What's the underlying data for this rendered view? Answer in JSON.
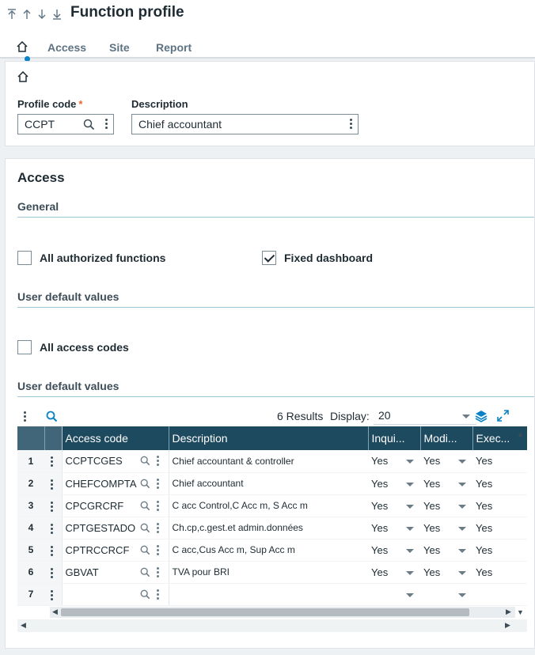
{
  "header": {
    "title": "Function profile",
    "nav": {
      "first_icon": "first-record-icon",
      "prev_icon": "previous-record-icon",
      "next_icon": "next-record-icon",
      "last_icon": "last-record-icon"
    }
  },
  "tabs": {
    "home_icon": "home-icon",
    "items": [
      "Access",
      "Site",
      "Report"
    ]
  },
  "form": {
    "profile_code_label": "Profile code",
    "required_mark": "*",
    "profile_code_value": "CCPT",
    "description_label": "Description",
    "description_value": "Chief accountant"
  },
  "access": {
    "title": "Access",
    "general_label": "General",
    "all_authorized_functions_label": "All authorized functions",
    "all_authorized_functions_checked": false,
    "fixed_dashboard_label": "Fixed dashboard",
    "fixed_dashboard_checked": true,
    "user_default_values_label": "User default values",
    "all_access_codes_label": "All access codes",
    "all_access_codes_checked": false,
    "user_default_values_label_2": "User default values"
  },
  "grid": {
    "results_text": "6 Results",
    "display_label": "Display:",
    "display_value": "20",
    "columns": [
      "Access code",
      "Description",
      "Inqui...",
      "Modi...",
      "Exec..."
    ],
    "rows": [
      {
        "num": "1",
        "code": "CCPTCGES",
        "description": "Chief accountant & controller",
        "inquiry": "Yes",
        "modify": "Yes",
        "execute": "Yes"
      },
      {
        "num": "2",
        "code": "CHEFCOMPTA",
        "description": "Chief accountant",
        "inquiry": "Yes",
        "modify": "Yes",
        "execute": "Yes"
      },
      {
        "num": "3",
        "code": "CPCGRCRF",
        "description": "C acc Control,C Acc m, S Acc m",
        "inquiry": "Yes",
        "modify": "Yes",
        "execute": "Yes"
      },
      {
        "num": "4",
        "code": "CPTGESTADO",
        "description": "Ch.cp,c.gest.et admin.données",
        "inquiry": "Yes",
        "modify": "Yes",
        "execute": "Yes"
      },
      {
        "num": "5",
        "code": "CPTRCCRCF",
        "description": "C acc,Cus Acc m, Sup Acc m",
        "inquiry": "Yes",
        "modify": "Yes",
        "execute": "Yes"
      },
      {
        "num": "6",
        "code": "GBVAT",
        "description": "TVA pour BRI",
        "inquiry": "Yes",
        "modify": "Yes",
        "execute": "Yes"
      },
      {
        "num": "7",
        "code": "",
        "description": "",
        "inquiry": "",
        "modify": "",
        "execute": ""
      }
    ]
  },
  "colors": {
    "accent": "#0a82c8",
    "grid_header": "#1e4a5f",
    "required": "#e8672b"
  }
}
